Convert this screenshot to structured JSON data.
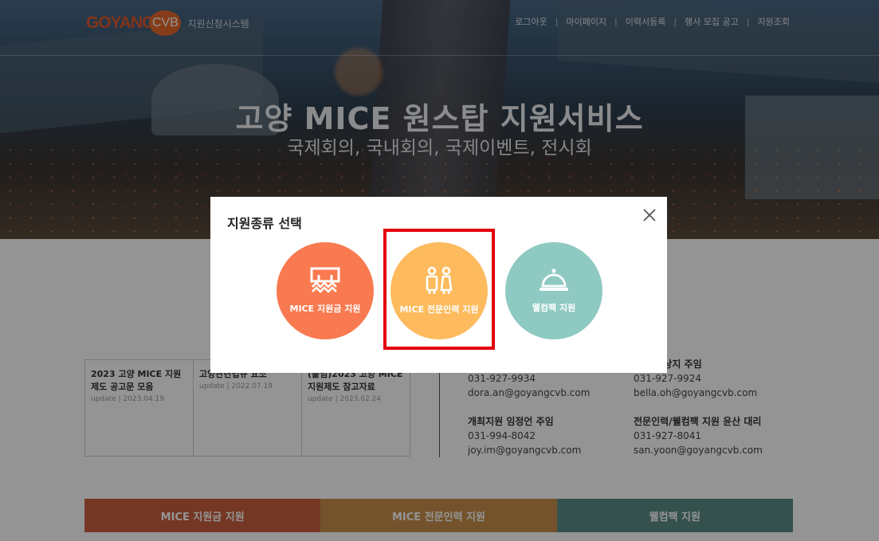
{
  "header": {
    "logo_text": "GOYANG",
    "logo_badge": "CVB",
    "system_name": "지원신청시스템",
    "nav": [
      {
        "label": "로그아웃"
      },
      {
        "label": "마이페이지"
      },
      {
        "label": "이력서등록"
      },
      {
        "label": "행사 모집 공고"
      },
      {
        "label": "지원조회"
      }
    ]
  },
  "hero": {
    "title": "고양 MICE 원스탑 지원서비스",
    "subtitle": "국제회의, 국내회의, 국제이벤트, 전시회"
  },
  "notices": [
    {
      "title": "2023 고양 MICE 지원제도 공고문 모음",
      "date": "update | 2023.04.19"
    },
    {
      "title": "고양관련법규 요조",
      "date": "update | 2022.07.19"
    },
    {
      "title": "(붙임)2023 고양 MICE 지원제도 참고자료",
      "date": "update | 2023.02.24"
    }
  ],
  "contacts": [
    {
      "name": "",
      "phone": "031-927-9934",
      "email": "dora.an@goyangcvb.com"
    },
    {
      "name": "지원 오상지 주임",
      "phone": "031-927-9924",
      "email": "bella.oh@goyangcvb.com"
    },
    {
      "name": "개최지원 임정언 주임",
      "phone": "031-994-8042",
      "email": "joy.im@goyangcvb.com"
    },
    {
      "name": "전문인력/웰컴팩 지원 윤산 대리",
      "phone": "031-927-8041",
      "email": "san.yoon@goyangcvb.com"
    }
  ],
  "bottom_tabs": [
    {
      "label": "MICE 지원금 지원",
      "color": "#c9603f"
    },
    {
      "label": "MICE 전문인력 지원",
      "color": "#c8904d"
    },
    {
      "label": "웰컴팩 지원",
      "color": "#5a8c86"
    }
  ],
  "modal": {
    "title": "지원종류 선택",
    "close_icon": "close-icon",
    "options": [
      {
        "label": "MICE 지원금 지원",
        "color": "#f97a50",
        "icon": "stage-icon"
      },
      {
        "label": "MICE 전문인력 지원",
        "color": "#fdbb5e",
        "icon": "staff-icon"
      },
      {
        "label": "웰컴팩 지원",
        "color": "#8ec9c2",
        "icon": "service-bell-icon"
      }
    ],
    "highlight_color": "#e3000f"
  }
}
